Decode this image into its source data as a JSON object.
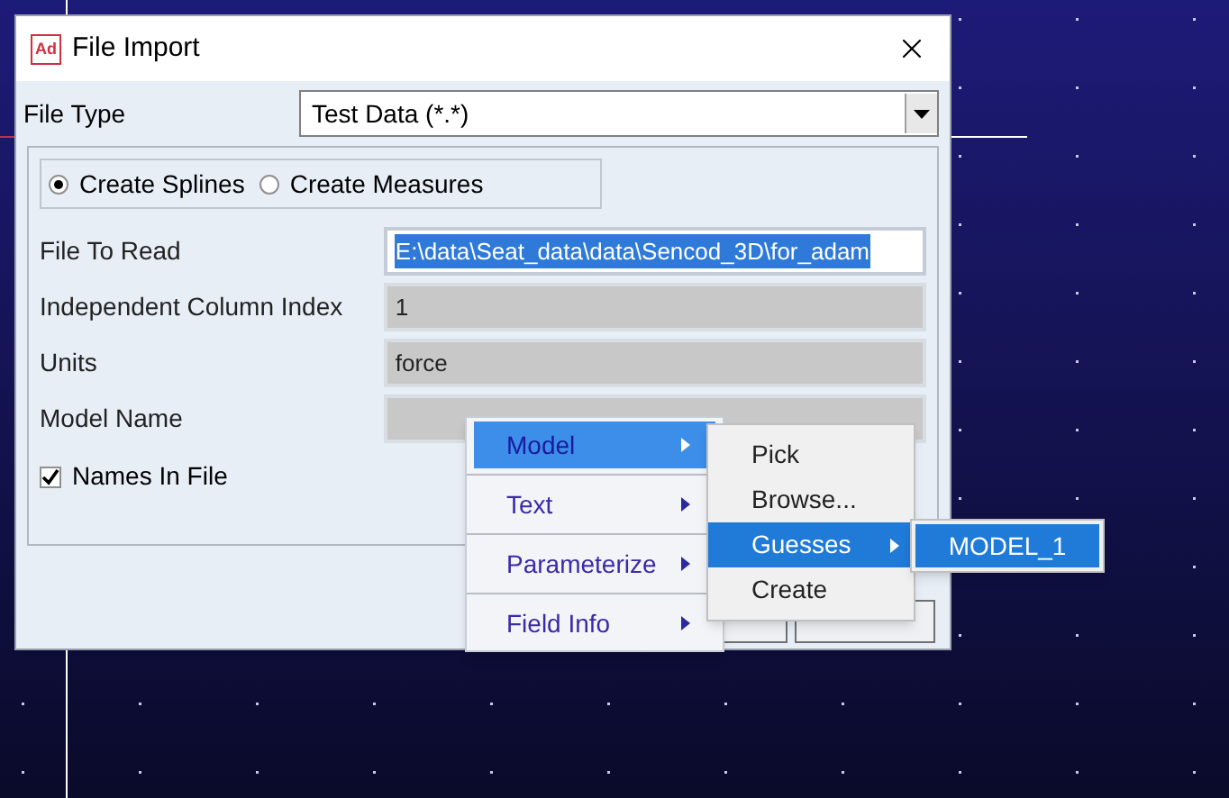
{
  "window": {
    "title": "File Import",
    "app_icon_text": "Ad"
  },
  "file_type": {
    "label": "File Type",
    "value": "Test Data (*.*)"
  },
  "radios": [
    {
      "label": "Create Splines",
      "selected": true
    },
    {
      "label": "Create Measures",
      "selected": false
    }
  ],
  "fields": [
    {
      "label": "File To Read",
      "value": "E:\\data\\Seat_data\\data\\Sencod_3D\\for_adam",
      "selected": true,
      "disabled": false
    },
    {
      "label": "Independent Column Index",
      "value": "1",
      "selected": false,
      "disabled": true
    },
    {
      "label": "Units",
      "value": "force",
      "selected": false,
      "disabled": true
    },
    {
      "label": "Model Name",
      "selected": false,
      "disabled": true
    }
  ],
  "checkbox": {
    "label": "Names In File",
    "checked": true
  },
  "context_menu": [
    {
      "label": "Model",
      "selected": true
    },
    {
      "label": "Text",
      "selected": false
    },
    {
      "label": "Parameterize",
      "selected": false
    },
    {
      "label": "Field Info",
      "selected": false
    }
  ],
  "model_submenu": [
    {
      "label": "Pick",
      "kind": "action",
      "selected": false
    },
    {
      "label": "Browse...",
      "kind": "action",
      "selected": false
    },
    {
      "label": "Guesses",
      "kind": "submenu",
      "selected": true
    },
    {
      "label": "Create",
      "kind": "action",
      "selected": false
    }
  ],
  "guesses_submenu": [
    {
      "label": "MODEL_1",
      "selected": true
    }
  ]
}
